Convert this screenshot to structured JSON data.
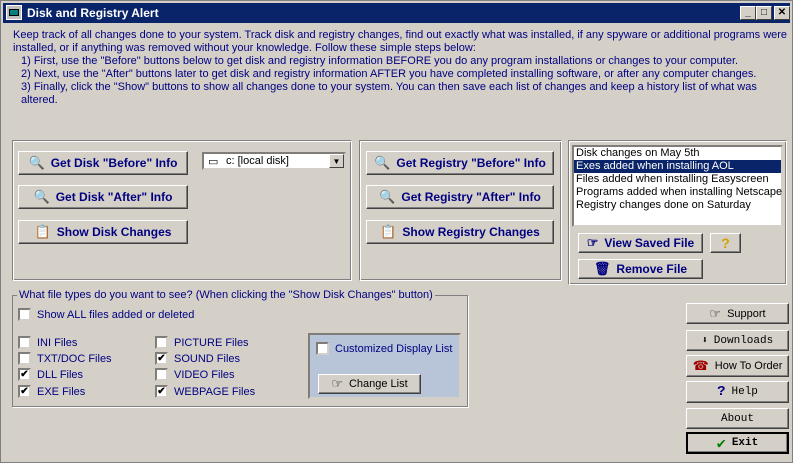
{
  "window": {
    "title": "Disk and Registry Alert",
    "minimize": "_",
    "maximize": "□",
    "close": "✕"
  },
  "intro": {
    "text": "Keep track of all changes done to your system. Track disk and registry changes, find out exactly what was installed, if any spyware or additional programs were installed, or if anything was removed without your knowledge. Follow these simple steps below:",
    "step1": "1) First, use the \"Before\" buttons below to get disk and registry information BEFORE you do any program installations or changes to your computer.",
    "step2": "2) Next, use the \"After\" buttons later to get disk and registry information AFTER you have completed installing software, or after any computer changes.",
    "step3": "3) Finally, click the \"Show\" buttons to show all changes done to your system. You can then save each list of changes and keep a history list of what was altered."
  },
  "disk": {
    "before_label": "Get Disk \"Before\" Info",
    "after_label": "Get Disk \"After\" Info",
    "show_label": "Show Disk Changes",
    "drive_value": "c: [local disk]"
  },
  "registry": {
    "before_label": "Get Registry \"Before\" Info",
    "after_label": "Get Registry \"After\" Info",
    "show_label": "Show Registry Changes"
  },
  "saved": {
    "items": [
      "Disk changes on May 5th",
      "Exes added when installing AOL",
      "Files added when installing Easyscreen",
      "Programs added when installing Netscape",
      "Registry changes done on Saturday"
    ],
    "selected_index": 1,
    "view_label": "View Saved File",
    "help_label": "?",
    "remove_label": "Remove File"
  },
  "filetypes": {
    "legend": "What file types do you want to see? (When clicking the \"Show Disk Changes\" button)",
    "show_all": "Show ALL files added or deleted",
    "ini": "INI Files",
    "txt": "TXT/DOC Files",
    "dll": "DLL Files",
    "exe": "EXE Files",
    "picture": "PICTURE Files",
    "sound": "SOUND Files",
    "video": "VIDEO Files",
    "webpage": "WEBPAGE Files",
    "custom": "Customized Display List",
    "change_list": "Change List",
    "check": "✔"
  },
  "side": {
    "support": "Support",
    "downloads": "Downloads",
    "how_to_order": "How To Order",
    "help": "Help",
    "about": "About",
    "exit": "Exit"
  }
}
